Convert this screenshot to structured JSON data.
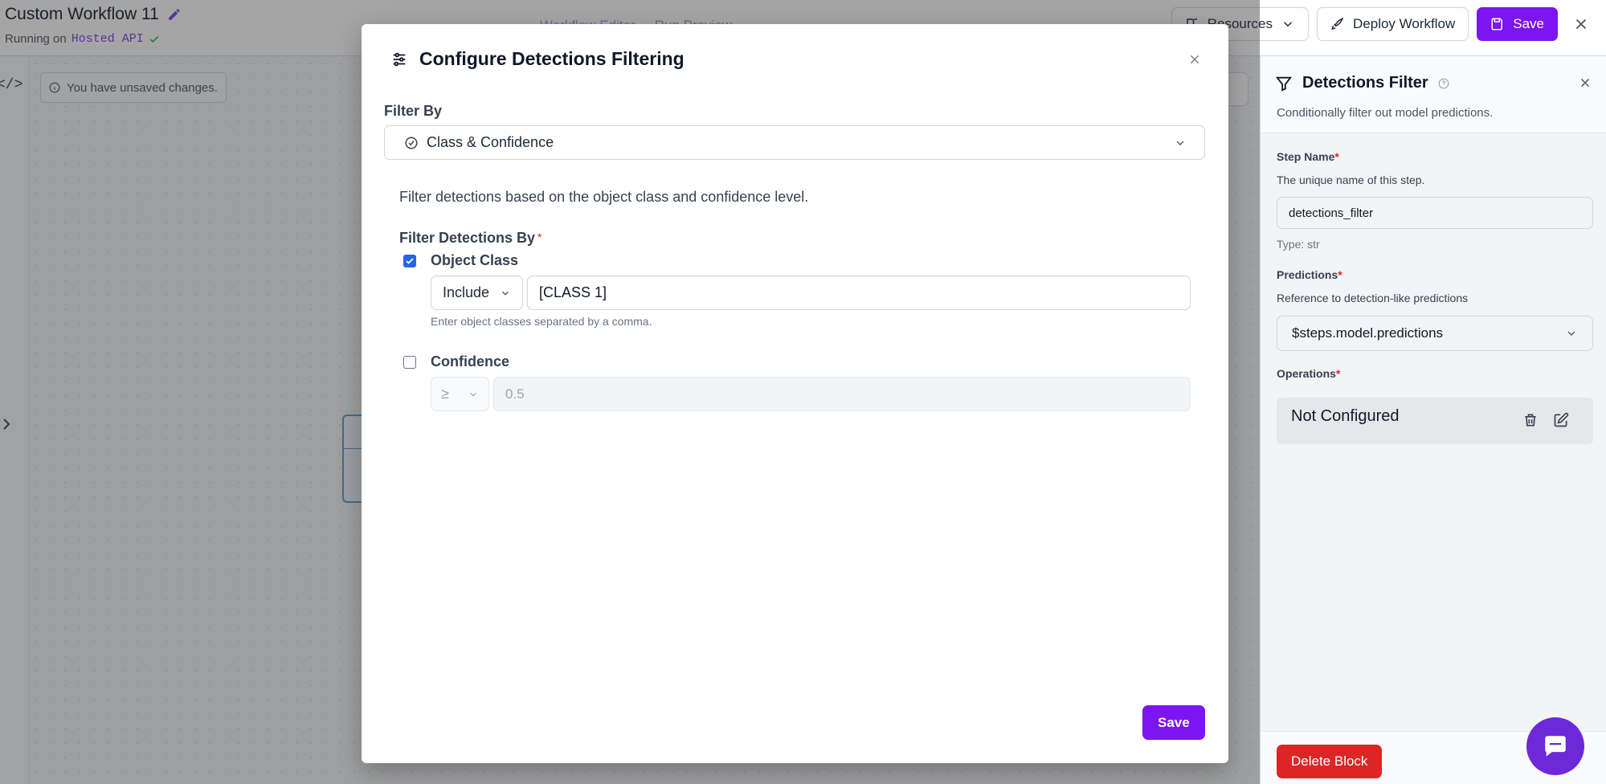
{
  "header": {
    "workflow_title": "Custom Workflow 11",
    "running_prefix": "Running on",
    "running_target": "Hosted API",
    "tab_editor": "Workflow Editor",
    "tab_run": "Run Preview",
    "resources_label": "Resources",
    "deploy_label": "Deploy Workflow",
    "save_label": "Save"
  },
  "canvas": {
    "code_toggle": "</>",
    "unsaved_notice": "You have unsaved changes."
  },
  "modal": {
    "title": "Configure Detections Filtering",
    "filter_by_label": "Filter By",
    "filter_by_value": "Class & Confidence",
    "help_text": "Filter detections based on the object class and confidence level.",
    "filter_detections_by_label": "Filter Detections By",
    "required_mark": "*",
    "object_class": {
      "label": "Object Class",
      "checked": true,
      "mode": "Include",
      "value": "[CLASS 1]",
      "hint": "Enter object classes separated by a comma."
    },
    "confidence": {
      "label": "Confidence",
      "checked": false,
      "operator": "≥",
      "placeholder": "0.5"
    },
    "save_label": "Save"
  },
  "panel": {
    "title": "Detections Filter",
    "subtitle": "Conditionally filter out model predictions.",
    "step_name_label": "Step Name",
    "step_name_desc": "The unique name of this step.",
    "step_name_value": "detections_filter",
    "step_name_type": "Type: str",
    "predictions_label": "Predictions",
    "predictions_desc": "Reference to detection-like predictions",
    "predictions_value": "$steps.model.predictions",
    "operations_label": "Operations",
    "operations_value": "Not Configured",
    "required_mark": "*",
    "delete_label": "Delete Block"
  },
  "colors": {
    "primary": "#7c15f0",
    "danger": "#dc2626",
    "checkbox": "#2563eb",
    "chat": "#6d28d9"
  }
}
